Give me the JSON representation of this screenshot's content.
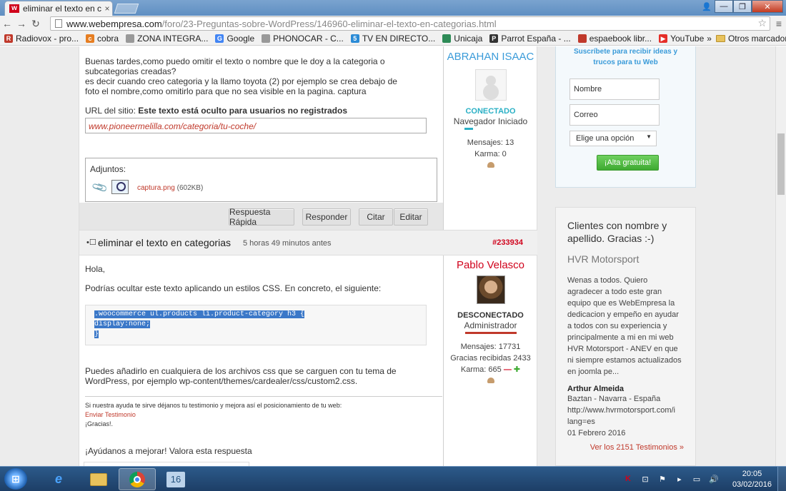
{
  "browser": {
    "tab_title": "eliminar el texto en c",
    "tab_close": "×",
    "favicon": "w",
    "url_host": "www.webempresa.com",
    "url_path": "/foro/23-Preguntas-sobre-WordPress/146960-eliminar-el-texto-en-categorias.html",
    "bookmarks": [
      {
        "label": "Radiovox - pro...",
        "icon": "R",
        "color": "#c0392b"
      },
      {
        "label": "cobra",
        "icon": "c",
        "color": "#e67e22"
      },
      {
        "label": "ZONA INTEGRA...",
        "icon": "",
        "color": "#999999"
      },
      {
        "label": "Google",
        "icon": "G",
        "color": "#4285f4"
      },
      {
        "label": "PHONOCAR - C...",
        "icon": "",
        "color": "#999999"
      },
      {
        "label": "TV EN DIRECTO...",
        "icon": "5",
        "color": "#2b8bd6"
      },
      {
        "label": "Unicaja",
        "icon": "",
        "color": "#2e8b57"
      },
      {
        "label": "Parrot España - ...",
        "icon": "P",
        "color": "#333333"
      },
      {
        "label": "espaebook libr...",
        "icon": "",
        "color": "#c0392b"
      },
      {
        "label": "YouTube",
        "icon": "▶",
        "color": "#e52d27"
      }
    ],
    "bookmarks_more": "»",
    "other_bookmarks": "Otros marcadores"
  },
  "post1": {
    "text1": "Buenas tardes,como puedo omitir el texto o nombre que le doy a la categoria o subcategorias creadas?",
    "text2": "es decir cuando creo categoria y la llamo toyota (2) por ejemplo se crea debajo de foto el nombre,como omitirlo para que no sea visible en la pagina. captura",
    "url_label": "URL del sitio:",
    "url_hidden": "Este texto está oculto para usuarios no registrados",
    "url_value": "www.pioneermelilla.com/categoria/tu-coche/",
    "attachments_label": "Adjuntos:",
    "attachment_name": "captura.png",
    "attachment_size": "(602KB)",
    "actions": [
      "Respuesta Rápida",
      "Responder",
      "Citar",
      "Editar"
    ],
    "user": {
      "name": "ABRAHAN ISAAC",
      "status": "CONECTADO",
      "rank": "Navegador Iniciado",
      "messages": "Mensajes: 13",
      "karma": "Karma: 0"
    }
  },
  "post2": {
    "title": "eliminar el texto en categorias",
    "time": "5 horas 49 minutos antes",
    "id": "#233934",
    "text1": "Hola,",
    "text2": "Podrías ocultar este texto aplicando un estilos CSS. En concreto, el siguiente:",
    "code": [
      ".woocommerce ul.products li.product-category h3 {",
      "display:none;",
      "}"
    ],
    "text3": "Puedes añadirlo en cualquiera de los archivos css que se carguen con tu tema de WordPress, por ejemplo wp-content/themes/cardealer/css/custom2.css.",
    "testimonial_prompt": "Si nuestra ayuda te sirve déjanos tu testimonio y mejora así el posicionamiento de tu web:",
    "testimonial_link": "Enviar Testimonio",
    "thanks": "¡Gracias!.",
    "rate": "¡Ayúdanos a mejorar! Valora esta respuesta",
    "user": {
      "name": "Pablo Velasco",
      "status": "DESCONECTADO",
      "rank": "Administrador",
      "messages": "Mensajes: 17731",
      "thanks": "Gracias recibidas 2433",
      "karma": "Karma: 665"
    }
  },
  "subscribe": {
    "title_line1": "Suscríbete para recibir ideas y",
    "title_line2": "trucos para tu Web",
    "name_placeholder": "Nombre",
    "email_placeholder": "Correo",
    "select_value": "Elige una opción",
    "button": "¡Alta gratuita!"
  },
  "testimonials": {
    "title": "Clientes con nombre y apellido. Gracias :-)",
    "company": "HVR Motorsport",
    "body": "Wenas a todos. Quiero agradecer a todo este gran equipo que es WebEmpresa la dedicacion y empeño en ayudar a todos con su experiencia y principalmente a mi en mi web HVR Motorsport - ANEV en que ni siempre estamos actualizados en joomla pe...",
    "author": "Arthur Almeida",
    "location": "Baztan - Navarra - España",
    "site": "http://www.hvrmotorsport.com/i lang=es",
    "date": "01 Febrero 2016",
    "more": "Ver los 2151 Testimonios »"
  },
  "taskbar": {
    "badge": "16",
    "time": "20:05",
    "date": "03/02/2016"
  },
  "colors": {
    "accent_red": "#d0021b",
    "link_blue": "#3a9bd9",
    "online_teal": "#2ab0c5",
    "green_button": "#3eaa31"
  }
}
